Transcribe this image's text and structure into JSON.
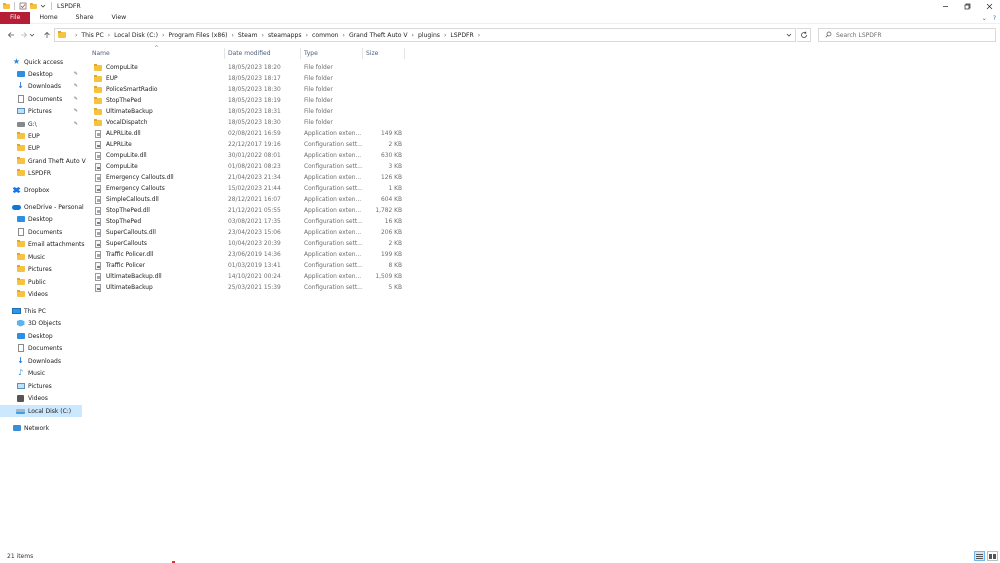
{
  "window": {
    "title": "LSPDFR",
    "qat_icons": [
      "folder-icon",
      "properties-icon",
      "new-folder-icon",
      "qat-dropdown-icon"
    ]
  },
  "ribbon": {
    "tabs": [
      "File",
      "Home",
      "Share",
      "View"
    ],
    "expand_glyph": "⌄",
    "help_glyph": "?"
  },
  "address": {
    "crumbs": [
      "This PC",
      "Local Disk (C:)",
      "Program Files (x86)",
      "Steam",
      "steamapps",
      "common",
      "Grand Theft Auto V",
      "plugins",
      "LSPDFR"
    ]
  },
  "search": {
    "placeholder": "Search LSPDFR"
  },
  "sidebar": {
    "quick_access": {
      "label": "Quick access",
      "items": [
        {
          "label": "Desktop",
          "icon": "desktop-icon",
          "pinned": true
        },
        {
          "label": "Downloads",
          "icon": "download-icon",
          "pinned": true
        },
        {
          "label": "Documents",
          "icon": "documents-icon",
          "pinned": true
        },
        {
          "label": "Pictures",
          "icon": "pictures-icon",
          "pinned": true
        },
        {
          "label": "G:\\",
          "icon": "drive-icon",
          "pinned": true
        },
        {
          "label": "EUP",
          "icon": "folder-icon",
          "pinned": false
        },
        {
          "label": "EUP",
          "icon": "folder-icon",
          "pinned": false
        },
        {
          "label": "Grand Theft Auto V",
          "icon": "folder-icon",
          "pinned": false
        },
        {
          "label": "LSPDFR",
          "icon": "folder-icon",
          "pinned": false
        }
      ]
    },
    "dropbox": {
      "label": "Dropbox"
    },
    "onedrive": {
      "label": "OneDrive - Personal",
      "items": [
        {
          "label": "Desktop",
          "icon": "desktop-icon"
        },
        {
          "label": "Documents",
          "icon": "documents-icon"
        },
        {
          "label": "Email attachments",
          "icon": "folder-icon"
        },
        {
          "label": "Music",
          "icon": "folder-icon"
        },
        {
          "label": "Pictures",
          "icon": "folder-icon"
        },
        {
          "label": "Public",
          "icon": "folder-icon"
        },
        {
          "label": "Videos",
          "icon": "folder-icon"
        }
      ]
    },
    "this_pc": {
      "label": "This PC",
      "items": [
        {
          "label": "3D Objects",
          "icon": "3d-objects-icon"
        },
        {
          "label": "Desktop",
          "icon": "desktop-icon"
        },
        {
          "label": "Documents",
          "icon": "documents-icon"
        },
        {
          "label": "Downloads",
          "icon": "download-icon"
        },
        {
          "label": "Music",
          "icon": "music-icon"
        },
        {
          "label": "Pictures",
          "icon": "pictures-icon"
        },
        {
          "label": "Videos",
          "icon": "videos-icon"
        },
        {
          "label": "Local Disk (C:)",
          "icon": "drive-icon",
          "selected": true
        }
      ]
    },
    "network": {
      "label": "Network"
    }
  },
  "columns": [
    "Name",
    "Date modified",
    "Type",
    "Size"
  ],
  "files": [
    {
      "name": "CompuLite",
      "date": "18/05/2023 18:20",
      "type": "File folder",
      "size": "",
      "kind": "folder"
    },
    {
      "name": "EUP",
      "date": "18/05/2023 18:17",
      "type": "File folder",
      "size": "",
      "kind": "folder"
    },
    {
      "name": "PoliceSmartRadio",
      "date": "18/05/2023 18:30",
      "type": "File folder",
      "size": "",
      "kind": "folder"
    },
    {
      "name": "StopThePed",
      "date": "18/05/2023 18:19",
      "type": "File folder",
      "size": "",
      "kind": "folder"
    },
    {
      "name": "UltimateBackup",
      "date": "18/05/2023 18:31",
      "type": "File folder",
      "size": "",
      "kind": "folder"
    },
    {
      "name": "VocalDispatch",
      "date": "18/05/2023 18:30",
      "type": "File folder",
      "size": "",
      "kind": "folder"
    },
    {
      "name": "ALPRLite.dll",
      "date": "02/08/2021 16:59",
      "type": "Application exten...",
      "size": "149 KB",
      "kind": "dll"
    },
    {
      "name": "ALPRLite",
      "date": "22/12/2017 19:16",
      "type": "Configuration sett...",
      "size": "2 KB",
      "kind": "cfg"
    },
    {
      "name": "CompuLite.dll",
      "date": "30/01/2022 08:01",
      "type": "Application exten...",
      "size": "630 KB",
      "kind": "dll"
    },
    {
      "name": "CompuLite",
      "date": "01/08/2021 08:23",
      "type": "Configuration sett...",
      "size": "3 KB",
      "kind": "cfg"
    },
    {
      "name": "Emergency Callouts.dll",
      "date": "21/04/2023 21:34",
      "type": "Application exten...",
      "size": "126 KB",
      "kind": "dll"
    },
    {
      "name": "Emergency Callouts",
      "date": "15/02/2023 21:44",
      "type": "Configuration sett...",
      "size": "1 KB",
      "kind": "cfg"
    },
    {
      "name": "SimpleCallouts.dll",
      "date": "28/12/2021 16:07",
      "type": "Application exten...",
      "size": "604 KB",
      "kind": "dll"
    },
    {
      "name": "StopThePed.dll",
      "date": "21/12/2021 05:55",
      "type": "Application exten...",
      "size": "1,782 KB",
      "kind": "dll"
    },
    {
      "name": "StopThePed",
      "date": "03/08/2021 17:35",
      "type": "Configuration sett...",
      "size": "16 KB",
      "kind": "cfg"
    },
    {
      "name": "SuperCallouts.dll",
      "date": "23/04/2023 15:06",
      "type": "Application exten...",
      "size": "206 KB",
      "kind": "dll"
    },
    {
      "name": "SuperCallouts",
      "date": "10/04/2023 20:39",
      "type": "Configuration sett...",
      "size": "2 KB",
      "kind": "cfg"
    },
    {
      "name": "Traffic Policer.dll",
      "date": "23/06/2019 14:36",
      "type": "Application exten...",
      "size": "199 KB",
      "kind": "dll"
    },
    {
      "name": "Traffic Policer",
      "date": "01/03/2019 13:41",
      "type": "Configuration sett...",
      "size": "8 KB",
      "kind": "cfg"
    },
    {
      "name": "UltimateBackup.dll",
      "date": "14/10/2021 00:24",
      "type": "Application exten...",
      "size": "1,509 KB",
      "kind": "dll"
    },
    {
      "name": "UltimateBackup",
      "date": "25/03/2021 15:39",
      "type": "Configuration sett...",
      "size": "5 KB",
      "kind": "cfg"
    }
  ],
  "status": {
    "item_count": "21 items"
  },
  "colors": {
    "file_tab": "#b51e34",
    "selection": "#cce8ff",
    "folder": "#f5c242"
  }
}
